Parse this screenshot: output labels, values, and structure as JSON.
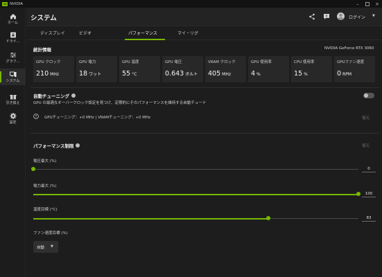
{
  "window": {
    "app_name": "NVIDIA",
    "controls": [
      "minimize-icon",
      "maximize-icon",
      "close-icon"
    ]
  },
  "sidebar": {
    "items": [
      {
        "label": "ホーム",
        "icon": "home-icon"
      },
      {
        "label": "ドライ...",
        "icon": "driver-icon"
      },
      {
        "label": "グラフ...",
        "icon": "graphics-sliders-icon"
      },
      {
        "label": "システム",
        "icon": "system-icon",
        "active": true
      },
      {
        "label": "引き換え",
        "icon": "gift-icon"
      },
      {
        "label": "設定",
        "icon": "gear-icon"
      }
    ]
  },
  "header": {
    "title": "システム",
    "login_label": "ログイン",
    "icons": [
      "share-icon",
      "feedback-icon",
      "avatar",
      "chevron-down-icon"
    ]
  },
  "tabs": [
    {
      "label": "ディスプレイ"
    },
    {
      "label": "ビデオ"
    },
    {
      "label": "パフォーマンス",
      "active": true
    },
    {
      "label": "マイ・リグ"
    }
  ],
  "stats": {
    "title": "統計情報",
    "gpu_name": "NVIDIA GeForce RTX 3060",
    "cards": [
      {
        "label": "GPU クロック",
        "value": "210",
        "unit": "MHz"
      },
      {
        "label": "GPU 電力",
        "value": "18",
        "unit": "ワット"
      },
      {
        "label": "GPU 温度",
        "value": "55",
        "unit": "°C"
      },
      {
        "label": "GPU 電圧",
        "value": "0.643",
        "unit": "ボルト"
      },
      {
        "label": "VRAM クロック",
        "value": "405",
        "unit": "MHz"
      },
      {
        "label": "GPU 使用率",
        "value": "4",
        "unit": "%"
      },
      {
        "label": "CPU 使用率",
        "value": "15",
        "unit": "%"
      },
      {
        "label": "GPUファン速度",
        "value": "0",
        "unit": "RPM"
      }
    ]
  },
  "auto_tuning": {
    "title": "自動チューニング",
    "description": "GPU の最適なオーバークロック設定を見つけ、定期的にそのパフォーマンスを維持する自動チューナ",
    "status": "GPUチューニング：+0 MHz  |  VRAMチューニング：+0 MHz",
    "reset_label": "復元",
    "enabled": false
  },
  "performance_limits": {
    "title": "パフォーマンス制限",
    "reset_label": "復元",
    "sliders": [
      {
        "label": "電圧最大 (%)",
        "value": "0",
        "fraction": 0.0
      },
      {
        "label": "電力最大 (%)",
        "value": "100",
        "fraction": 1.0
      },
      {
        "label": "温度目標 (°C)",
        "value": "83",
        "fraction": 0.723
      }
    ],
    "fan_label": "ファン速度目標 (%)",
    "fan_mode": "自動"
  },
  "colors": {
    "accent": "#76b900",
    "background": "#1d1d1d",
    "card": "#282828"
  }
}
